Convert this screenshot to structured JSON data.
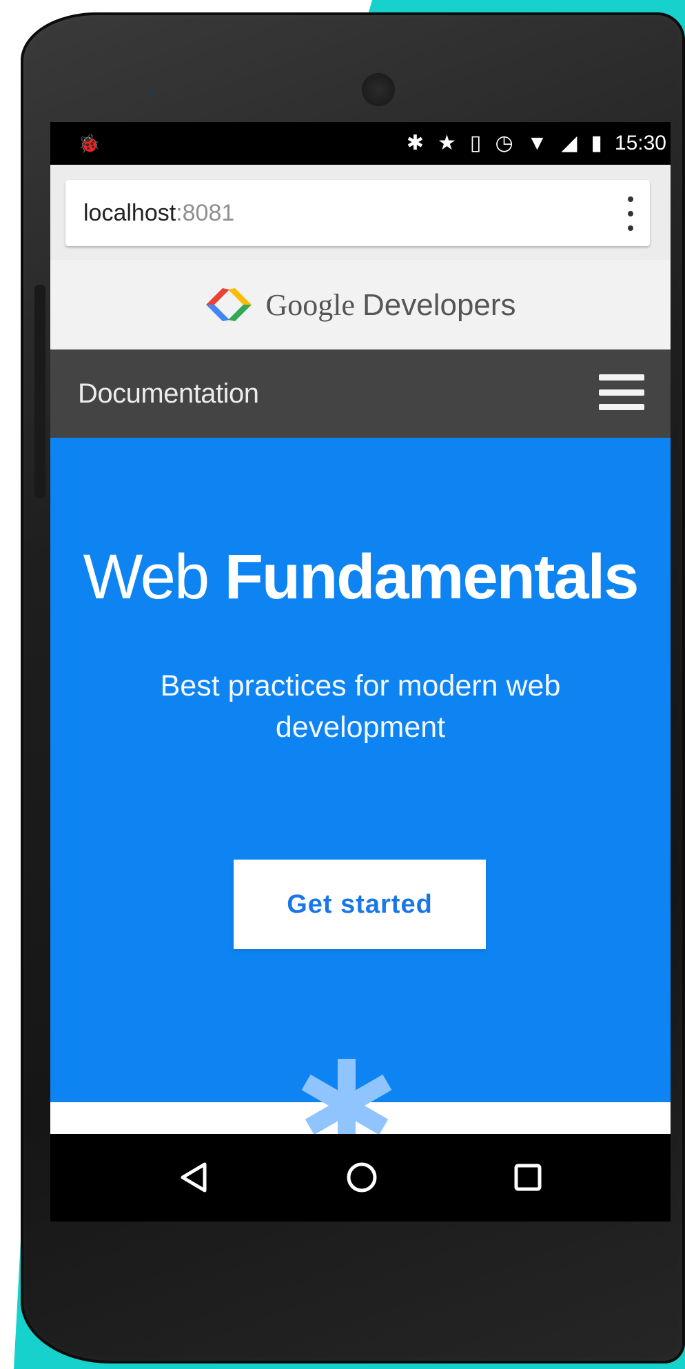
{
  "status_bar": {
    "time": "15:30",
    "icons": [
      "android-debug-icon",
      "bluetooth-icon",
      "star-icon",
      "vibrate-icon",
      "alarm-icon",
      "wifi-icon",
      "signal-icon",
      "battery-charging-icon"
    ]
  },
  "url_bar": {
    "host": "localhost",
    "port": ":8081"
  },
  "brand": {
    "google": "Google",
    "developers": "Developers"
  },
  "nav": {
    "title": "Documentation"
  },
  "hero": {
    "title_light": "Web",
    "title_bold": "Fundamentals",
    "subtitle": "Best practices for modern web development",
    "cta_label": "Get started"
  },
  "colors": {
    "hero_blue": "#0d84f2",
    "doc_bar": "#444444",
    "teal_background": "#17d2cc",
    "cta_text": "#1a76e6"
  }
}
